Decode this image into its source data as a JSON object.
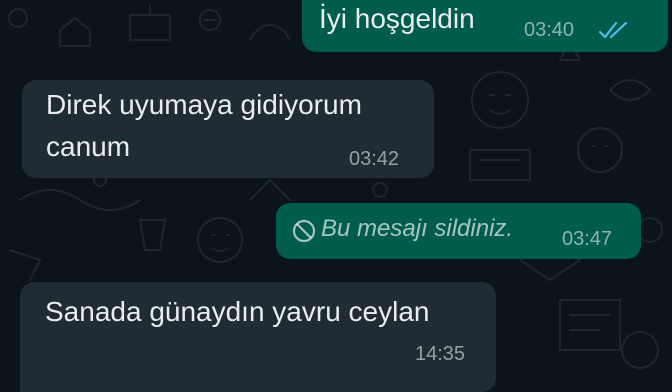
{
  "chat": {
    "messages": [
      {
        "direction": "outgoing",
        "text": "İyi hoşgeldin",
        "time": "03:40",
        "status_icon": "double-check-read-icon"
      },
      {
        "direction": "incoming",
        "lines": [
          "Direk uyumaya gidiyorum",
          "canum"
        ],
        "time": "03:42"
      },
      {
        "direction": "outgoing",
        "deleted": true,
        "icon": "no-entry-icon",
        "text": "Bu mesajı sildiniz.",
        "time": "03:47"
      },
      {
        "direction": "incoming",
        "text": "Sanada günaydın yavru ceylan",
        "time": "14:35"
      }
    ]
  },
  "colors": {
    "background": "#0b141a",
    "outgoing_bubble": "#005c4b",
    "incoming_bubble": "#1f2c34",
    "text": "#e9edef",
    "read_ticks": "#53bdeb"
  }
}
